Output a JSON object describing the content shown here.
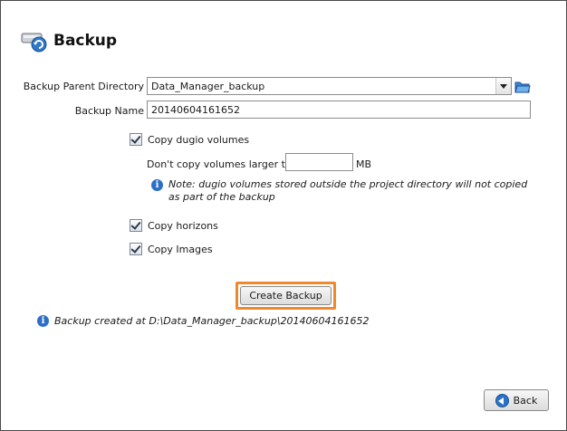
{
  "header": {
    "title": "Backup",
    "icon": "backup-drive-icon"
  },
  "form": {
    "parent_dir_label": "Backup Parent Directory",
    "parent_dir_value": "Data_Manager_backup",
    "backup_name_label": "Backup Name",
    "backup_name_value": "20140604161652"
  },
  "options": {
    "copy_dugio_label": "Copy dugio volumes",
    "copy_dugio_checked": true,
    "size_limit_label": "Don't copy volumes larger than",
    "size_limit_value": "",
    "size_unit": "MB",
    "note": "Note: dugio volumes stored outside the project directory will not copied as part of the backup",
    "copy_horizons_label": "Copy horizons",
    "copy_horizons_checked": true,
    "copy_images_label": "Copy Images",
    "copy_images_checked": true
  },
  "actions": {
    "create_label": "Create Backup",
    "back_label": "Back"
  },
  "status": {
    "message": "Backup created at D:\\Data_Manager_backup\\20140604161652"
  },
  "colors": {
    "highlight": "#f0892b",
    "info": "#2d6fc6"
  }
}
